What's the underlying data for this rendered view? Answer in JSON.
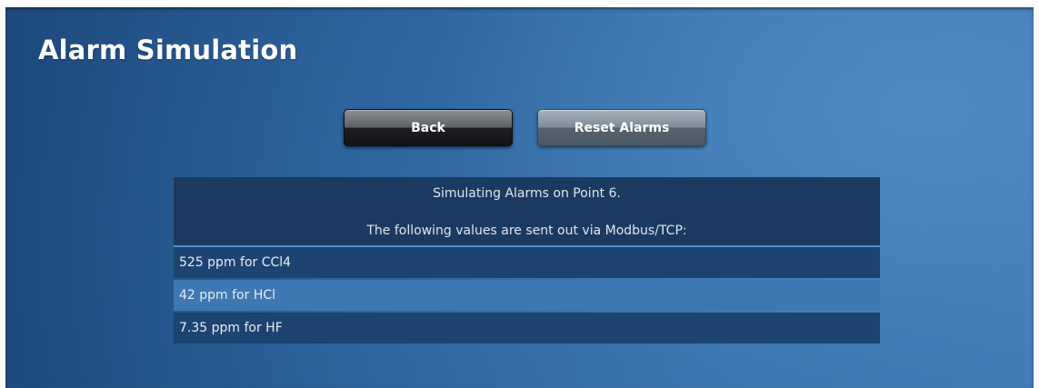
{
  "page": {
    "title": "Alarm Simulation"
  },
  "buttons": {
    "back_label": "Back",
    "reset_label": "Reset Alarms"
  },
  "panel": {
    "header_line1": "Simulating Alarms on Point 6.",
    "header_line2": "The following values are sent out via Modbus/TCP:",
    "rows": [
      {
        "text": "525 ppm for CCl4"
      },
      {
        "text": "42 ppm for HCl"
      },
      {
        "text": "7.35 ppm for HF"
      }
    ]
  },
  "colors": {
    "background_dark": "#1e4a7e",
    "background_light": "#3f7bb6",
    "panel_header": "#1a3a5f",
    "row_dark": "#1d4470",
    "row_light": "#3f77b2",
    "back_button": "#1c1e21",
    "reset_button": "#7e8c99"
  }
}
